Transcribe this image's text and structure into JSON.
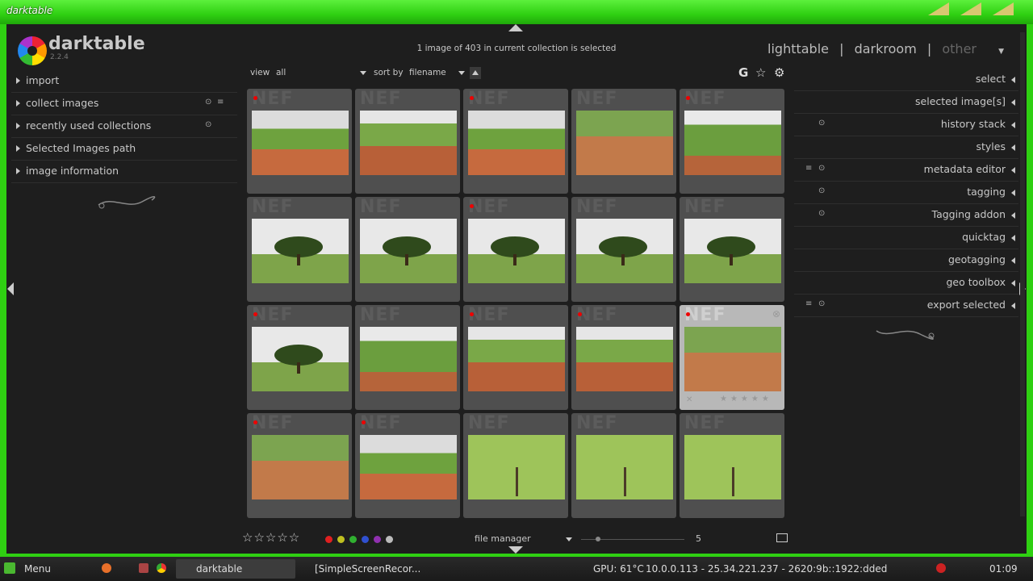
{
  "window": {
    "title": "darktable"
  },
  "app": {
    "name": "darktable",
    "version": "2.2.4"
  },
  "status": {
    "selection_text": "1 image of 403 in current collection is selected"
  },
  "views": {
    "lighttable": "lighttable",
    "sep1": "|",
    "darkroom": "darkroom",
    "sep2": "|",
    "other": "other"
  },
  "left_panel": {
    "modules": [
      {
        "label": "import"
      },
      {
        "label": "collect images"
      },
      {
        "label": "recently used collections"
      },
      {
        "label": "Selected Images path"
      },
      {
        "label": "image information"
      }
    ]
  },
  "toolbar": {
    "view_label": "view",
    "view_value": "all",
    "sort_label": "sort by",
    "sort_value": "filename",
    "grouping_letter": "G"
  },
  "thumbs": {
    "watermark": "NEF",
    "selected_index": 14,
    "altered": [
      true,
      false,
      true,
      false,
      true,
      false,
      false,
      true,
      false,
      false,
      true,
      false,
      true,
      true,
      true,
      true,
      true,
      false,
      false,
      false
    ]
  },
  "bottom": {
    "layout_label": "file manager",
    "zoom_value": "5",
    "color_labels": [
      "#e02020",
      "#c0c020",
      "#30b030",
      "#3050d0",
      "#9030b0",
      "#bbbbbb"
    ]
  },
  "right_panel": {
    "modules": [
      {
        "label": "select"
      },
      {
        "label": "selected image[s]"
      },
      {
        "label": "history stack"
      },
      {
        "label": "styles"
      },
      {
        "label": "metadata editor"
      },
      {
        "label": "tagging"
      },
      {
        "label": "Tagging addon"
      },
      {
        "label": "quicktag"
      },
      {
        "label": "geotagging"
      },
      {
        "label": "geo toolbox"
      },
      {
        "label": "export selected"
      }
    ]
  },
  "taskbar": {
    "menu_label": "Menu",
    "task1": "darktable",
    "task2": "[SimpleScreenRecor...",
    "gpu": "GPU: 61°C",
    "network": "10.0.0.113 - 25.34.221.237 - 2620:9b::1922:dded",
    "clock": "01:09"
  }
}
